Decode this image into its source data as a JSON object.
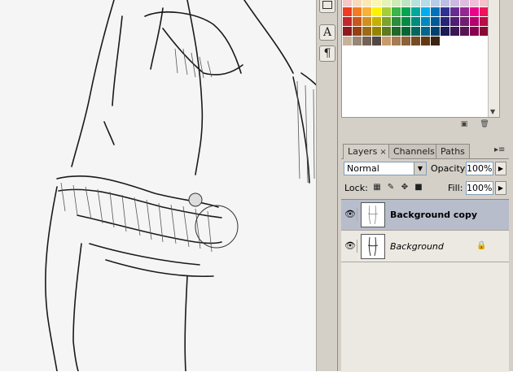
{
  "toolbar": {
    "type_tool_label": "A",
    "paragraph_tool_label": "¶"
  },
  "swatches": {
    "rows": [
      [
        "#f7c6c6",
        "#f8d9b9",
        "#fbe9b1",
        "#fdf6b1",
        "#e7f3b6",
        "#cfecb6",
        "#bde5c3",
        "#b5e3dc",
        "#b4dcea",
        "#b6cce9",
        "#bcbde4",
        "#cbb9df",
        "#e0bbdf",
        "#f3bcd9",
        "#f7bfc9"
      ],
      [
        "#ef3b24",
        "#f47b20",
        "#f9b233",
        "#fff200",
        "#a6ce39",
        "#39b54a",
        "#00a651",
        "#00a99d",
        "#00aeef",
        "#0072bc",
        "#2e3192",
        "#662d91",
        "#92278f",
        "#ec008c",
        "#ed145b"
      ],
      [
        "#c1272d",
        "#c7581d",
        "#d18f1f",
        "#c6b100",
        "#7ea32b",
        "#2a8c3c",
        "#008c44",
        "#008b80",
        "#0089bb",
        "#005a95",
        "#262675",
        "#511f72",
        "#731d70",
        "#b8006c",
        "#b80d47"
      ],
      [
        "#8e1a1e",
        "#944013",
        "#9d6b15",
        "#938400",
        "#5d7a1f",
        "#1f682c",
        "#006733",
        "#00685f",
        "#00668b",
        "#00426f",
        "#1b1b56",
        "#3b1654",
        "#551553",
        "#880050",
        "#870a34"
      ],
      [
        "#c7b299",
        "#998675",
        "#736357",
        "#534741",
        "#c69c6d",
        "#a67c52",
        "#8c6239",
        "#754c24",
        "#603913",
        "#3c2415"
      ]
    ],
    "footer_new_icon": "new-swatch-icon",
    "footer_delete_icon": "trash-icon"
  },
  "layers_panel": {
    "tabs": [
      {
        "label": "Layers",
        "active": true,
        "close": "×"
      },
      {
        "label": "Channels",
        "active": false
      },
      {
        "label": "Paths",
        "active": false
      }
    ],
    "menu_glyph": "▸≡",
    "blend_mode": "Normal",
    "opacity_label": "Opacity:",
    "opacity_value": "100%",
    "lock_label": "Lock:",
    "fill_label": "Fill:",
    "fill_value": "100%",
    "layers": [
      {
        "name": "Background copy",
        "visible": true,
        "selected": true,
        "locked": false
      },
      {
        "name": "Background",
        "visible": true,
        "selected": false,
        "locked": true
      }
    ]
  },
  "colors": {
    "panel_bg": "#d4d0c8",
    "selection": "#b8bdcc",
    "canvas_bg": "#f5f5f5"
  }
}
